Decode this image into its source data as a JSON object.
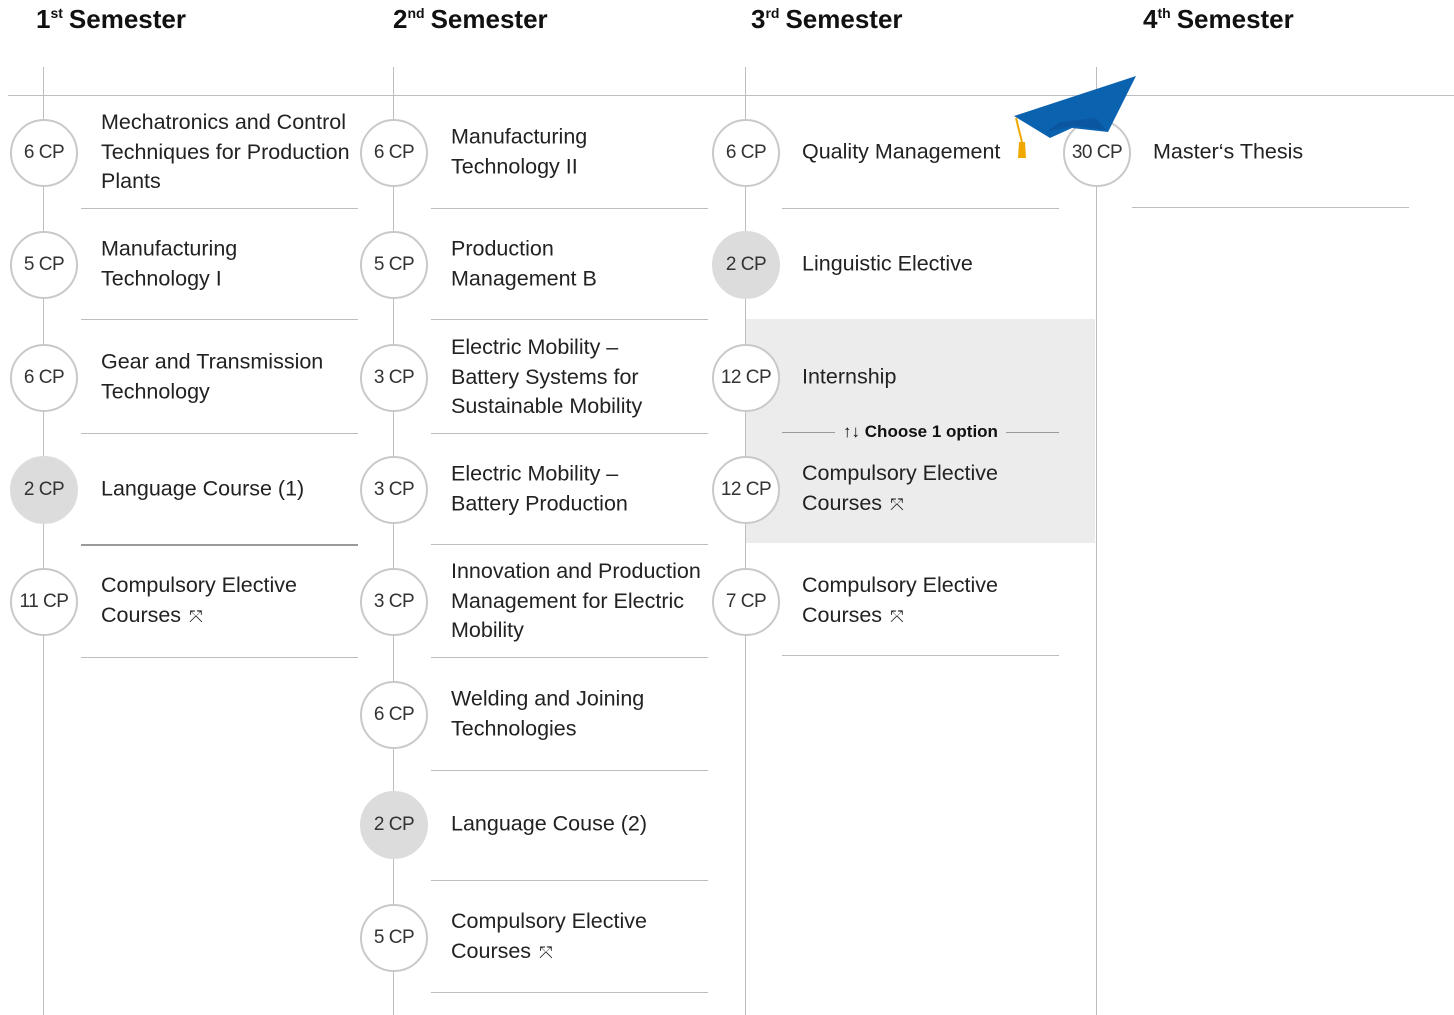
{
  "semesters": [
    {
      "num": "1",
      "suffix": "st",
      "word": "Semester"
    },
    {
      "num": "2",
      "suffix": "nd",
      "word": "Semester"
    },
    {
      "num": "3",
      "suffix": "rd",
      "word": "Semester"
    },
    {
      "num": "4",
      "suffix": "th",
      "word": "Semester"
    }
  ],
  "sem1": [
    {
      "cp": "6 CP",
      "title": "Mechatronics and Control Techniques for Production Plants"
    },
    {
      "cp": "5 CP",
      "title": "Manufacturing Technology I"
    },
    {
      "cp": "6 CP",
      "title": "Gear and Transmission Technology"
    },
    {
      "cp": "2 CP",
      "title": "Language Course (1)"
    },
    {
      "cp": "11 CP",
      "title": "Compulsory Elective Courses"
    }
  ],
  "sem2": [
    {
      "cp": "6 CP",
      "title": "Manufacturing Technology II"
    },
    {
      "cp": "5 CP",
      "title": "Production Management B"
    },
    {
      "cp": "3 CP",
      "title": "Electric Mobility – Battery Systems for Sustainable Mobility"
    },
    {
      "cp": "3 CP",
      "title": "Electric Mobility – Battery Production"
    },
    {
      "cp": "3 CP",
      "title": "Innovation and Production Management for Electric Mobility"
    },
    {
      "cp": "6 CP",
      "title": "Welding and Joining Technologies"
    },
    {
      "cp": "2 CP",
      "title": "Language Couse (2)"
    },
    {
      "cp": "5 CP",
      "title": "Compulsory Elective Courses"
    }
  ],
  "sem3": [
    {
      "cp": "6 CP",
      "title": "Quality Management"
    },
    {
      "cp": "2 CP",
      "title": "Linguistic Elective"
    },
    {
      "cp": "12 CP",
      "title": "Internship"
    },
    {
      "cp": "12 CP",
      "title": "Compulsory Elective Courses"
    },
    {
      "cp": "7 CP",
      "title": "Compulsory Elective Courses"
    }
  ],
  "sem4": [
    {
      "cp": "30 CP",
      "title": "Master‘s Thesis"
    }
  ],
  "choose_option": {
    "arrows": "↑↓",
    "text": "Choose 1 option"
  },
  "icons": {
    "expand": "expand-cross-icon",
    "graduation": "graduation-cap-icon"
  },
  "colors": {
    "cap": "#0b63b0",
    "tassel": "#f0a800",
    "optional_fill": "#dcdcdc",
    "elective_box": "#ececec"
  }
}
